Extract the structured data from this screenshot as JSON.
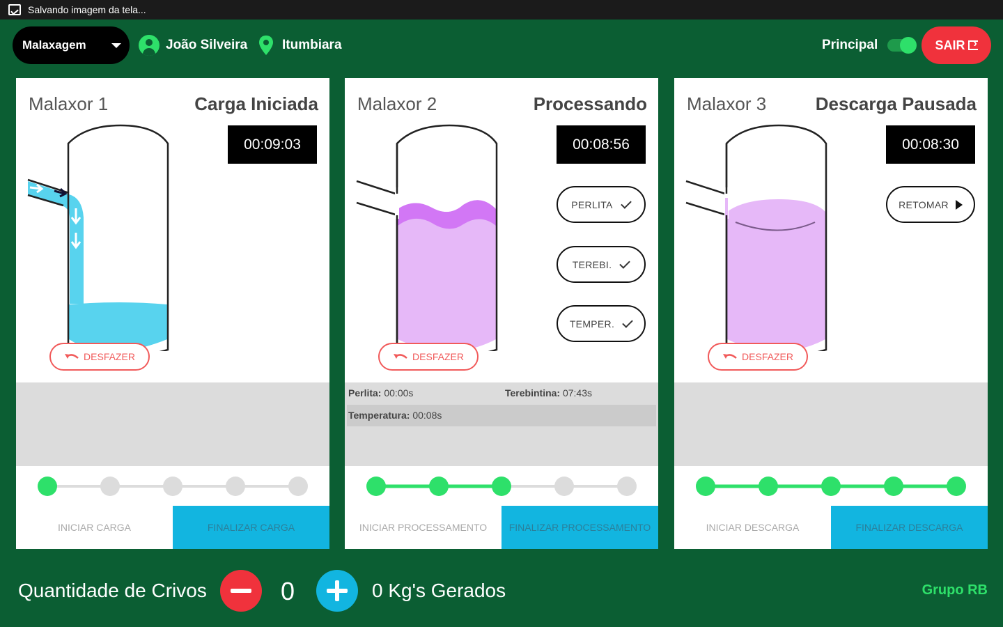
{
  "statusbar": {
    "text": "Salvando imagem da tela..."
  },
  "header": {
    "sector": "Malaxagem",
    "user": "João Silveira",
    "location": "Itumbiara",
    "mode_label": "Principal",
    "exit_label": "SAIR"
  },
  "colors": {
    "background": "#0b5e33",
    "accent_green": "#2ee06a",
    "exit_red": "#f0323c",
    "action_blue": "#12b5e0",
    "water": "#58d3ee",
    "mass": "#e6b8f8",
    "mass_top": "#d277f5"
  },
  "cards": [
    {
      "name": "Malaxor 1",
      "state": "Carga Iniciada",
      "timer": "00:09:03",
      "undo_label": "DESFAZER",
      "progress_steps": 5,
      "progress_done": 1,
      "actions": {
        "start": "INICIAR CARGA",
        "finish": "FINALIZAR CARGA"
      }
    },
    {
      "name": "Malaxor 2",
      "state": "Processando",
      "timer": "00:08:56",
      "undo_label": "DESFAZER",
      "ingredients": [
        "PERLITA",
        "TEREBI.",
        "TEMPER."
      ],
      "info": {
        "perlita_label": "Perlita:",
        "perlita_value": "00:00s",
        "terebintina_label": "Terebintina:",
        "terebintina_value": "07:43s",
        "temperatura_label": "Temperatura:",
        "temperatura_value": "00:08s"
      },
      "progress_steps": 5,
      "progress_done": 3,
      "actions": {
        "start": "INICIAR PROCESSAMENTO",
        "finish": "FINALIZAR PROCESSAMENTO"
      }
    },
    {
      "name": "Malaxor 3",
      "state": "Descarga Pausada",
      "timer": "00:08:30",
      "undo_label": "DESFAZER",
      "resume_label": "RETOMAR",
      "progress_steps": 5,
      "progress_done": 5,
      "actions": {
        "start": "INICIAR DESCARGA",
        "finish": "FINALIZAR DESCARGA"
      }
    }
  ],
  "footer": {
    "label": "Quantidade de Crivos",
    "count": "0",
    "generated": "0 Kg's Gerados",
    "brand": "Grupo RB"
  }
}
